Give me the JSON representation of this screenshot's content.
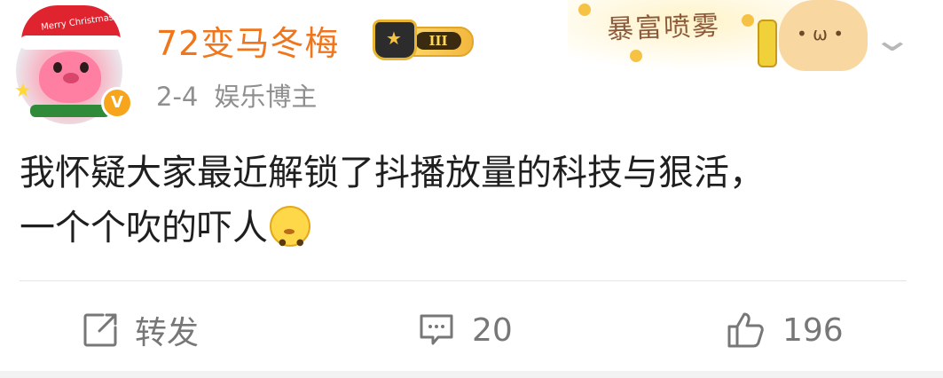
{
  "post": {
    "author": {
      "name": "72变马冬梅",
      "avatar_hat_text": "Merry Christmas",
      "verified_badge": "V",
      "level_badge": "III"
    },
    "meta": {
      "date": "2-4",
      "category": "娱乐博主"
    },
    "promo_banner": {
      "text": "暴富喷雾"
    },
    "content": {
      "line1": "我怀疑大家最近解锁了抖播放量的科技与狠活，",
      "line2": "一个个吹的吓人",
      "emoji": "thinking-face"
    },
    "actions": {
      "repost_label": "转发",
      "comment_count": "20",
      "like_count": "196"
    }
  },
  "colors": {
    "author_name": "#f0761d",
    "meta_text": "#8f8f8f",
    "content_text": "#1f1f1f",
    "action_text": "#777777"
  },
  "icons": [
    "chevron-down-icon",
    "repost-icon",
    "comment-icon",
    "like-icon",
    "crown-icon",
    "star-icon"
  ]
}
